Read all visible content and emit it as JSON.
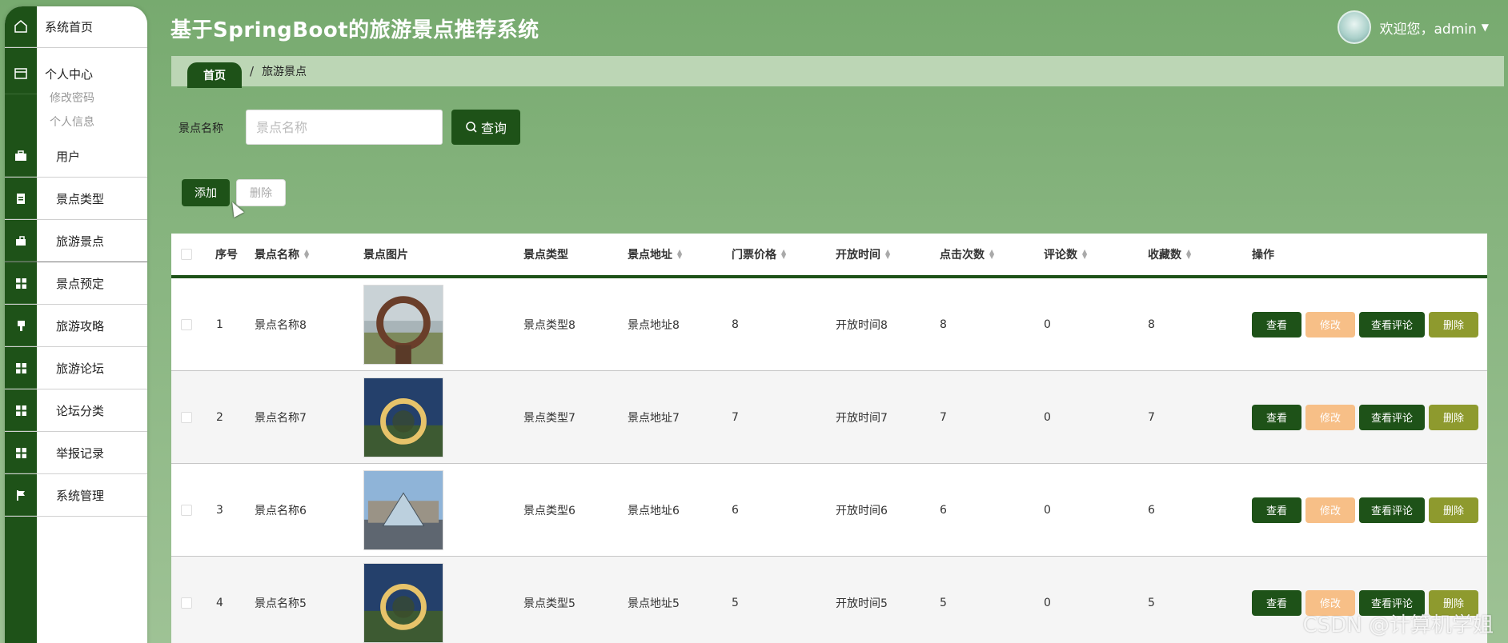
{
  "app": {
    "title": "基于SpringBoot的旅游景点推荐系统"
  },
  "user": {
    "greeting": "欢迎您，admin"
  },
  "sidebar": {
    "home": "系统首页",
    "personal": "个人中心",
    "submenu": [
      "修改密码",
      "个人信息"
    ],
    "items": [
      {
        "label": "用户",
        "icon": "briefcase-icon"
      },
      {
        "label": "景点类型",
        "icon": "clipboard-icon"
      },
      {
        "label": "旅游景点",
        "icon": "suitcase-icon"
      },
      {
        "label": "景点预定",
        "icon": "grid-icon"
      },
      {
        "label": "旅游攻略",
        "icon": "brush-icon"
      },
      {
        "label": "旅游论坛",
        "icon": "grid-icon"
      },
      {
        "label": "论坛分类",
        "icon": "grid-icon"
      },
      {
        "label": "举报记录",
        "icon": "grid-icon"
      },
      {
        "label": "系统管理",
        "icon": "flag-icon"
      }
    ]
  },
  "breadcrumb": {
    "home": "首页",
    "sep": "/",
    "current": "旅游景点"
  },
  "search": {
    "label": "景点名称",
    "placeholder": "景点名称",
    "button": "查询"
  },
  "actions": {
    "add": "添加",
    "delete": "删除"
  },
  "table": {
    "headers": [
      "序号",
      "景点名称",
      "景点图片",
      "景点类型",
      "景点地址",
      "门票价格",
      "开放时间",
      "点击次数",
      "评论数",
      "收藏数",
      "操作"
    ],
    "rows": [
      {
        "idx": "1",
        "name": "景点名称8",
        "type": "景点类型8",
        "addr": "景点地址8",
        "price": "8",
        "time": "开放时间8",
        "clicks": "8",
        "comments": "0",
        "favs": "8"
      },
      {
        "idx": "2",
        "name": "景点名称7",
        "type": "景点类型7",
        "addr": "景点地址7",
        "price": "7",
        "time": "开放时间7",
        "clicks": "7",
        "comments": "0",
        "favs": "7"
      },
      {
        "idx": "3",
        "name": "景点名称6",
        "type": "景点类型6",
        "addr": "景点地址6",
        "price": "6",
        "time": "开放时间6",
        "clicks": "6",
        "comments": "0",
        "favs": "6"
      },
      {
        "idx": "4",
        "name": "景点名称5",
        "type": "景点类型5",
        "addr": "景点地址5",
        "price": "5",
        "time": "开放时间5",
        "clicks": "5",
        "comments": "0",
        "favs": "5"
      }
    ],
    "ops": {
      "view": "查看",
      "edit": "修改",
      "comments": "查看评论",
      "delete": "删除"
    }
  },
  "watermark": "CSDN @计算机学姐",
  "colors": {
    "primary": "#1e5218",
    "edit": "#f7bf87",
    "delete": "#8e9a2e",
    "background": "#84b07d"
  }
}
